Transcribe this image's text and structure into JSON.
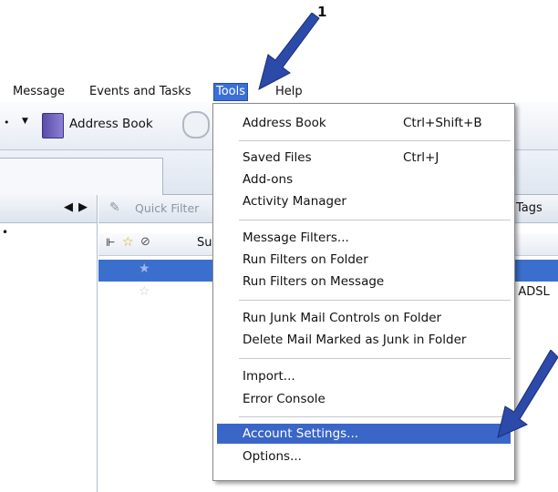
{
  "annotation": {
    "number": "1"
  },
  "menubar": {
    "items": [
      "Message",
      "Events and Tasks",
      "Tools",
      "Help"
    ]
  },
  "toolbar": {
    "address_book": "Address Book"
  },
  "thread_pane": {
    "quick_filter_placeholder": "Quick Filter",
    "tags_label": "Tags",
    "subject_col": "Su",
    "row2_text": "b ADSL"
  },
  "tools_menu": {
    "items": [
      {
        "label": "Address Book",
        "shortcut": "Ctrl+Shift+B"
      },
      {
        "label": "Saved Files",
        "shortcut": "Ctrl+J"
      },
      {
        "label": "Add-ons",
        "shortcut": ""
      },
      {
        "label": "Activity Manager",
        "shortcut": ""
      },
      {
        "label": "Message Filters...",
        "shortcut": ""
      },
      {
        "label": "Run Filters on Folder",
        "shortcut": ""
      },
      {
        "label": "Run Filters on Message",
        "shortcut": ""
      },
      {
        "label": "Run Junk Mail Controls on Folder",
        "shortcut": ""
      },
      {
        "label": "Delete Mail Marked as Junk in Folder",
        "shortcut": ""
      },
      {
        "label": "Import...",
        "shortcut": ""
      },
      {
        "label": "Error Console",
        "shortcut": ""
      },
      {
        "label": "Account Settings...",
        "shortcut": "",
        "highlighted": true
      },
      {
        "label": "Options...",
        "shortcut": ""
      }
    ]
  },
  "colors": {
    "menu_highlight": "#3a66c8",
    "arrow": "#2c4aa8",
    "selected_row": "#3a6fce"
  }
}
